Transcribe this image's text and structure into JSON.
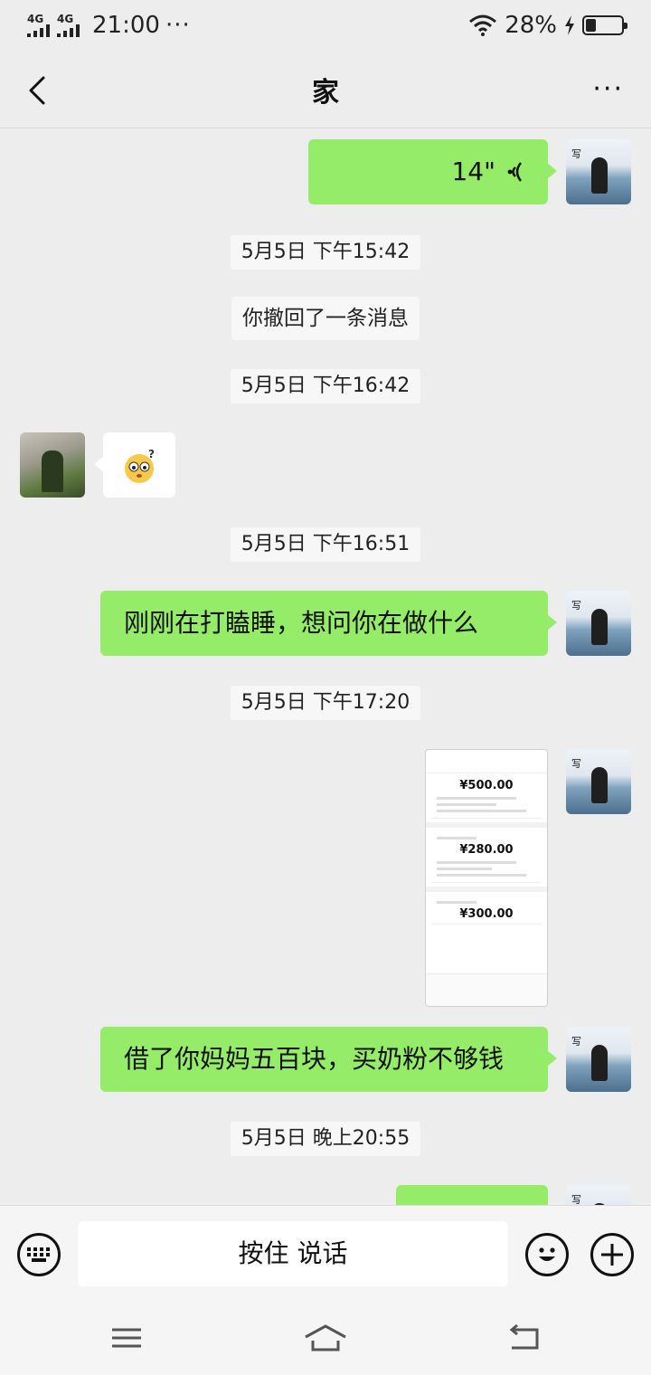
{
  "status_bar": {
    "signal1": "4G",
    "signal2": "4G",
    "time": "21:00",
    "dots": "···",
    "battery": "28%",
    "battery_level": 0.28
  },
  "header": {
    "title": "家",
    "more": "···"
  },
  "messages": {
    "voice": {
      "duration": "14\""
    },
    "ts1": "5月5日 下午15:42",
    "recall": "你撤回了一条消息",
    "ts2": "5月5日 下午16:42",
    "ts3": "5月5日 下午16:51",
    "text1": "刚刚在打瞌睡，想问你在做什么",
    "ts4": "5月5日 下午17:20",
    "screenshot": {
      "amount1": "¥500.00",
      "amount2": "¥280.00",
      "amount3": "¥300.00"
    },
    "text2": "借了你妈妈五百块，买奶粉不够钱",
    "ts5": "5月5日 晚上20:55"
  },
  "input_bar": {
    "hold_to_talk": "按住 说话"
  },
  "icons": {
    "back": "chevron-left-icon",
    "keyboard": "keyboard-icon",
    "emoji": "smile-icon",
    "add": "plus-icon",
    "voice": "voice-wave-icon",
    "sticker": "confused-face-sticker"
  },
  "colors": {
    "self_bubble": "#95ec69",
    "other_bubble": "#ffffff",
    "background": "#ededed"
  }
}
